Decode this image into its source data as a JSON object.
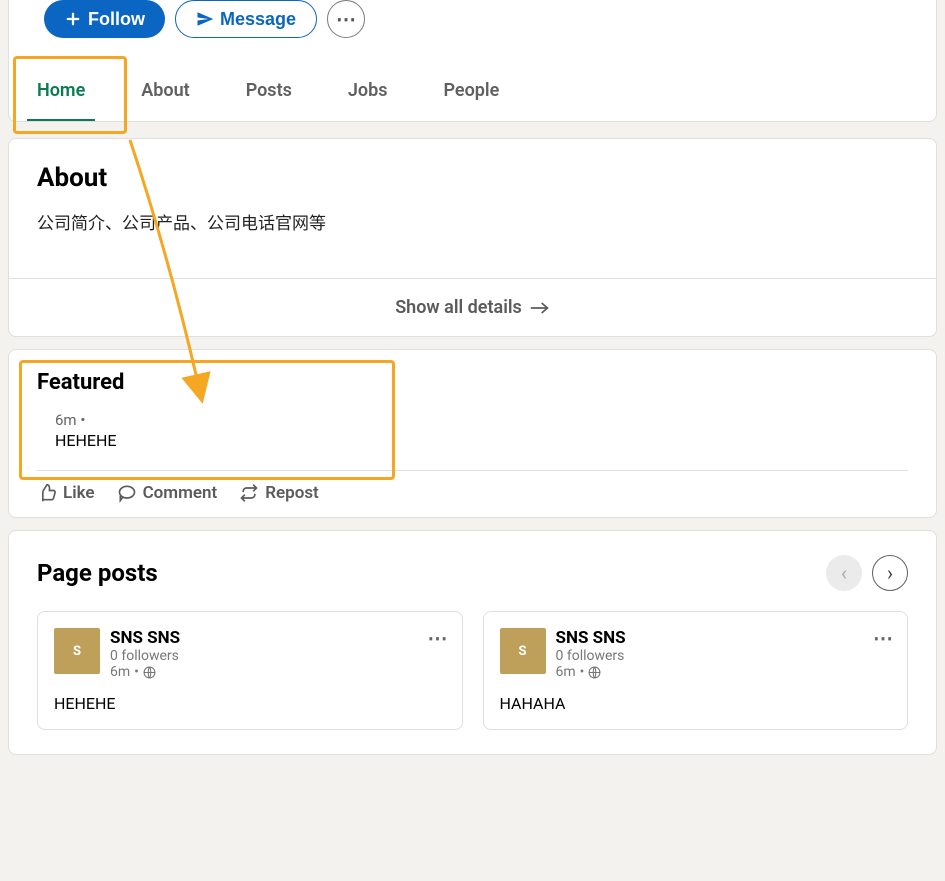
{
  "header": {
    "follow_label": "Follow",
    "message_label": "Message"
  },
  "tabs": {
    "items": [
      "Home",
      "About",
      "Posts",
      "Jobs",
      "People"
    ],
    "active_index": 0
  },
  "about": {
    "title": "About",
    "description": "公司简介、公司产品、公司电话官网等",
    "show_all_label": "Show all details"
  },
  "featured": {
    "title": "Featured",
    "time": "6m",
    "dot": "•",
    "text": "HEHEHE",
    "actions": {
      "like": "Like",
      "comment": "Comment",
      "repost": "Repost"
    }
  },
  "page_posts": {
    "title": "Page posts",
    "items": [
      {
        "name": "SNS SNS",
        "followers": "0 followers",
        "time": "6m",
        "dot": "•",
        "body": "HEHEHE"
      },
      {
        "name": "SNS SNS",
        "followers": "0 followers",
        "time": "6m",
        "dot": "•",
        "body": "HAHAHA"
      }
    ]
  }
}
